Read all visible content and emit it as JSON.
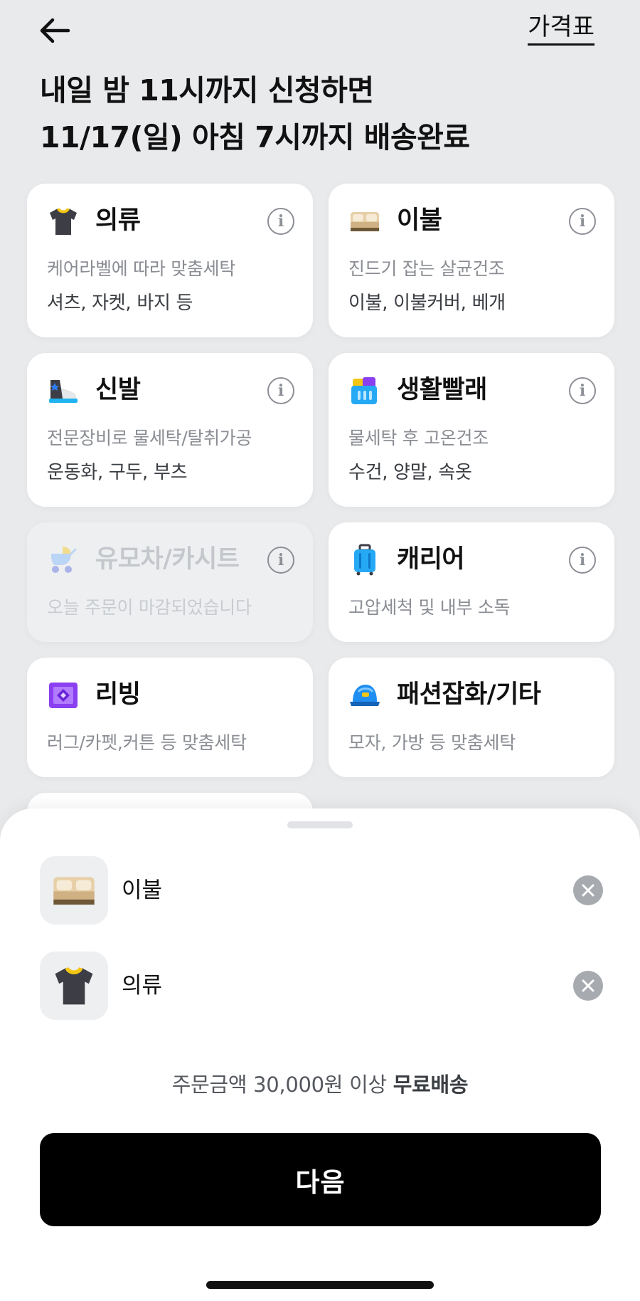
{
  "header": {
    "price_link": "가격표",
    "headline_line1": "내일 밤 11시까지 신청하면",
    "headline_line2": "11/17(일) 아침 7시까지 배송완료"
  },
  "categories": [
    {
      "title": "의류",
      "desc": "케어라벨에 따라 맞춤세탁",
      "items": "셔츠, 자켓, 바지 등",
      "icon": "tshirt-icon",
      "enabled": true
    },
    {
      "title": "이불",
      "desc": "진드기 잡는 살균건조",
      "items": "이불, 이불커버, 베개",
      "icon": "bed-icon",
      "enabled": true
    },
    {
      "title": "신발",
      "desc": "전문장비로 물세탁/탈취가공",
      "items": "운동화, 구두, 부츠",
      "icon": "sneaker-icon",
      "enabled": true
    },
    {
      "title": "생활빨래",
      "desc": "물세탁 후 고온건조",
      "items": "수건, 양말, 속옷",
      "icon": "laundry-basket-icon",
      "enabled": true
    },
    {
      "title": "유모차/카시트",
      "desc": "오늘 주문이 마감되었습니다",
      "items": "",
      "icon": "stroller-icon",
      "enabled": false
    },
    {
      "title": "캐리어",
      "desc": "고압세척 및 내부 소독",
      "items": "",
      "icon": "suitcase-icon",
      "enabled": true
    },
    {
      "title": "리빙",
      "desc": "러그/카펫,커튼 등 맞춤세탁",
      "items": "",
      "icon": "rug-icon",
      "enabled": true
    },
    {
      "title": "패션잡화/기타",
      "desc": "모자, 가방 등 맞춤세탁",
      "items": "",
      "icon": "cap-icon",
      "enabled": true
    }
  ],
  "info_glyph": "i",
  "selected": [
    {
      "label": "이불",
      "icon": "bed-icon"
    },
    {
      "label": "의류",
      "icon": "tshirt-icon"
    }
  ],
  "notice": {
    "prefix": "주문금액 30,000원 이상 ",
    "bold": "무료배송"
  },
  "next_button": "다음",
  "colors": {
    "background": "#e9eaec",
    "card": "#ffffff",
    "button": "#000000",
    "muted_text": "#8a8d93"
  }
}
